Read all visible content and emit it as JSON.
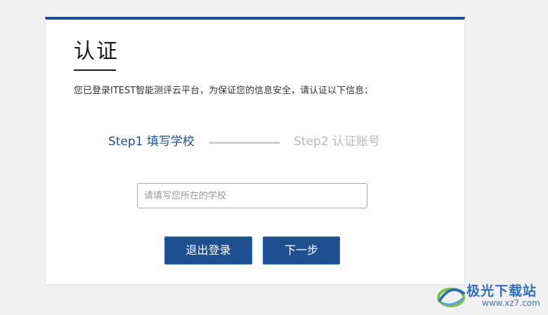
{
  "page": {
    "title": "认证",
    "notice": "您已登录ITEST智能测评云平台，为保证您的信息安全，请认证以下信息："
  },
  "steps": [
    {
      "label": "Step1 填写学校",
      "state": "active"
    },
    {
      "label": "Step2 认证账号",
      "state": "inactive"
    }
  ],
  "form": {
    "school_placeholder": "请填写您所在的学校",
    "school_value": ""
  },
  "buttons": {
    "logout_label": "退出登录",
    "next_label": "下一步"
  },
  "watermark": {
    "title": "极光下载站",
    "url": "www.xz7.com"
  },
  "colors": {
    "accent": "#1d4f91",
    "step_inactive": "#b9b9b9",
    "background": "#f1f1f1"
  }
}
